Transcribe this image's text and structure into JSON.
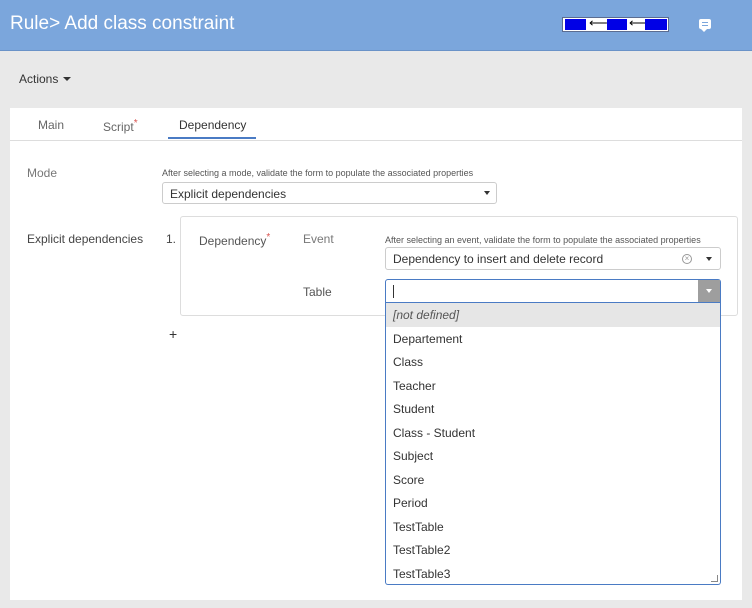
{
  "header": {
    "title": "Rule> Add class constraint"
  },
  "toolbar": {
    "actions_label": "Actions"
  },
  "tabs": [
    {
      "label": "Main",
      "required": false
    },
    {
      "label": "Script",
      "required": true
    },
    {
      "label": "Dependency",
      "required": false,
      "active": true
    }
  ],
  "required_marker": "*",
  "form": {
    "mode": {
      "label": "Mode",
      "help": "After selecting a mode, validate the form to populate the associated properties",
      "value": "Explicit dependencies"
    },
    "explicit_dependencies": {
      "label": "Explicit dependencies",
      "index": "1.",
      "dependency_label": "Dependency",
      "event": {
        "label": "Event",
        "help": "After selecting an event, validate the form to populate the associated properties",
        "value": "Dependency to insert and delete record"
      },
      "table": {
        "label": "Table",
        "value": ""
      },
      "add_label": "+"
    }
  },
  "dropdown": {
    "options": [
      "[not defined]",
      "Departement",
      "Class",
      "Teacher",
      "Student",
      "Class - Student",
      "Subject",
      "Score",
      "Period",
      "TestTable",
      "TestTable2",
      "TestTable3"
    ],
    "highlighted_index": 0
  },
  "colors": {
    "header_bg": "#7ba6dc",
    "accent": "#4a7bc4",
    "required": "#d9534f"
  }
}
